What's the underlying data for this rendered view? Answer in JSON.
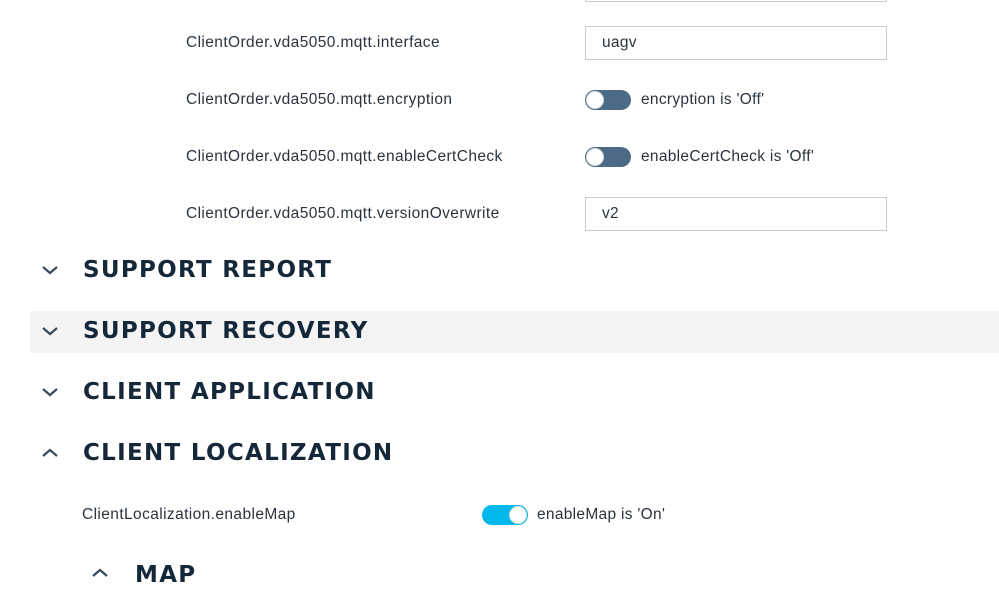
{
  "vda5050": {
    "interface": {
      "label": "ClientOrder.vda5050.mqtt.interface",
      "value": "uagv"
    },
    "encryption": {
      "label": "ClientOrder.vda5050.mqtt.encryption",
      "status": "encryption is 'Off'",
      "on": false
    },
    "enableCertCheck": {
      "label": "ClientOrder.vda5050.mqtt.enableCertCheck",
      "status": "enableCertCheck is 'Off'",
      "on": false
    },
    "versionOverwrite": {
      "label": "ClientOrder.vda5050.mqtt.versionOverwrite",
      "value": "v2"
    }
  },
  "sections": [
    {
      "title": "SUPPORT REPORT",
      "expanded": false,
      "icon": "chevron-down-icon"
    },
    {
      "title": "SUPPORT RECOVERY",
      "expanded": false,
      "icon": "chevron-down-icon"
    },
    {
      "title": "CLIENT APPLICATION",
      "expanded": false,
      "icon": "chevron-down-icon"
    },
    {
      "title": "CLIENT LOCALIZATION",
      "expanded": true,
      "icon": "chevron-up-icon"
    }
  ],
  "localization": {
    "enableMap": {
      "label": "ClientLocalization.enableMap",
      "status": "enableMap is 'On'",
      "on": true
    }
  },
  "subsection": {
    "title": "MAP",
    "icon": "chevron-up-icon"
  },
  "colors": {
    "toggle_off": "#4a6a85",
    "toggle_on": "#00b8ec",
    "heading": "#15283a",
    "hover_row": "#f4f4f5"
  }
}
